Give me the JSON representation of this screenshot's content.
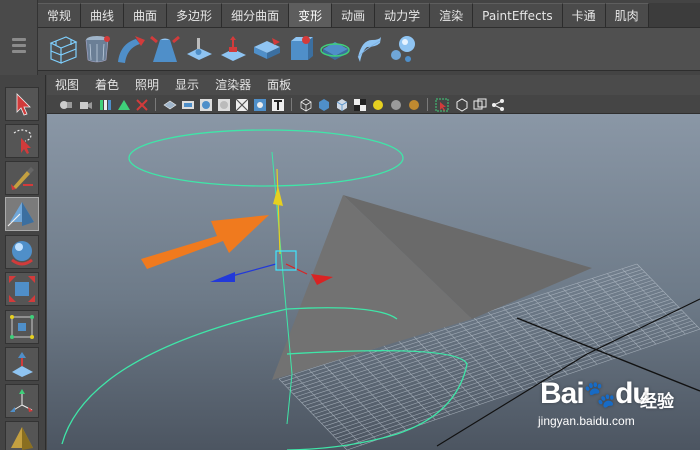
{
  "shelf": {
    "tabs": [
      {
        "label": "常规",
        "active": false
      },
      {
        "label": "曲线",
        "active": false
      },
      {
        "label": "曲面",
        "active": false
      },
      {
        "label": "多边形",
        "active": false
      },
      {
        "label": "细分曲面",
        "active": false
      },
      {
        "label": "变形",
        "active": true
      },
      {
        "label": "动画",
        "active": false
      },
      {
        "label": "动力学",
        "active": false
      },
      {
        "label": "渲染",
        "active": false
      },
      {
        "label": "PaintEffects",
        "active": false
      },
      {
        "label": "卡通",
        "active": false
      },
      {
        "label": "肌肉",
        "active": false
      }
    ],
    "icons": [
      "lattice-icon",
      "cluster-icon",
      "bend-icon",
      "flare-icon",
      "sculpt-icon",
      "soft-modifier-icon",
      "nonlinear-icon",
      "wrap-icon",
      "wave-icon",
      "wire-icon",
      "jiggle-icon"
    ]
  },
  "toolbox": {
    "tools": [
      "select-tool-icon",
      "lasso-tool-icon",
      "paint-select-tool-icon",
      "move-tool-icon",
      "rotate-tool-icon",
      "scale-tool-icon",
      "universal-manipulator-icon",
      "soft-modification-icon",
      "show-manipulator-icon",
      "cone-object-icon"
    ]
  },
  "panel": {
    "menu": [
      "视图",
      "着色",
      "照明",
      "显示",
      "渲染器",
      "面板"
    ]
  },
  "viewport": {
    "annotation_color": "#f07a1e",
    "manipulator_x_color": "#d92323",
    "manipulator_y_color": "#e6d020",
    "manipulator_z_color": "#2239d9",
    "curve_color": "#3fe6a8"
  },
  "watermark": {
    "logo": "Baidu",
    "brand": "经验",
    "url": "jingyan.baidu.com"
  }
}
